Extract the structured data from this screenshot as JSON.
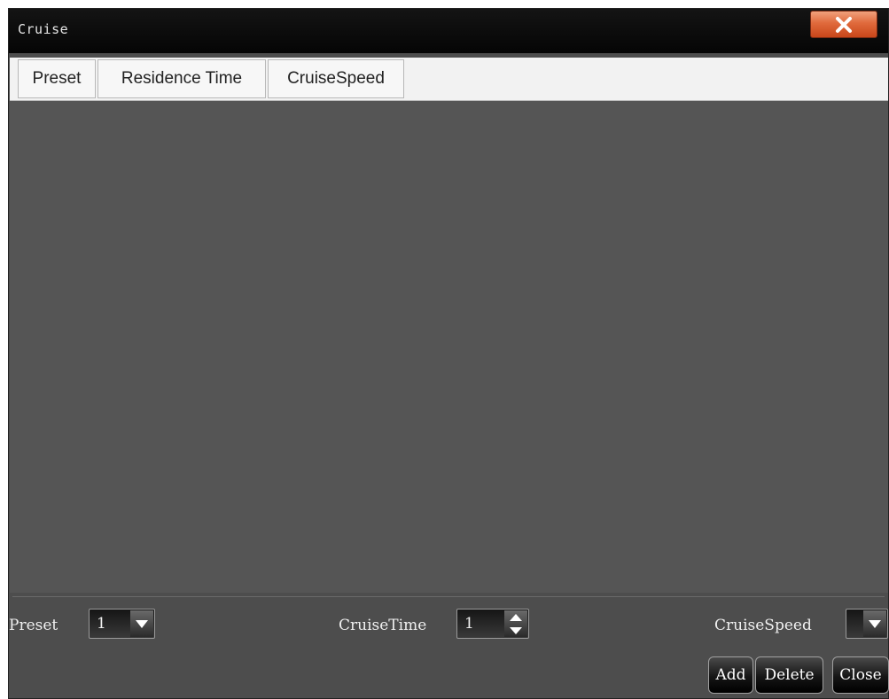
{
  "window": {
    "title": "Cruise"
  },
  "table": {
    "columns": [
      "Preset",
      "Residence Time",
      "CruiseSpeed"
    ]
  },
  "controls": {
    "preset": {
      "label": "Preset",
      "value": "1"
    },
    "cruise_time": {
      "label": "CruiseTime",
      "value": "1"
    },
    "cruise_speed": {
      "label": "CruiseSpeed",
      "value": ""
    }
  },
  "buttons": {
    "add": "Add",
    "delete": "Delete",
    "close": "Close"
  },
  "icons": {
    "close": "close-x-icon",
    "dropdown": "triangle-down-icon",
    "spin_up": "triangle-up-icon",
    "spin_down": "triangle-down-icon"
  },
  "colors": {
    "window_bg": "#4d4d4d",
    "titlebar_bg": "#0a0a0a",
    "close_button": "#e06a3c",
    "header_bg": "#f2f2f2"
  }
}
